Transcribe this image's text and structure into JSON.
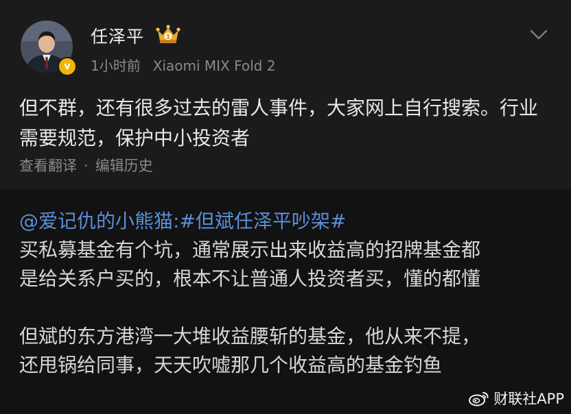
{
  "post": {
    "author": "任泽平",
    "time": "1小时前",
    "device": "Xiaomi MIX Fold 2",
    "verified_badge": "v",
    "text": "但不群，还有很多过去的雷人事件，大家网上自行搜索。行业需要规范，保护中小投资者",
    "actions": {
      "translate": "查看翻译",
      "separator": "·",
      "history": "编辑历史"
    }
  },
  "repost": {
    "mention": "@爱记仇的小熊猫",
    "colon": ":",
    "hashtag": "#但斌任泽平吵架#",
    "lines": [
      "买私募基金有个坑，通常展示出来收益高的招牌基金都",
      "是给关系户买的，根本不让普通人投资者买，懂的都懂",
      "但斌的东方港湾一大堆收益腰斩的基金，他从来不提，",
      "还甩锅给同事，天天吹嘘那几个收益高的基金钓鱼"
    ]
  },
  "watermark": {
    "text": "财联社APP"
  },
  "icons": {
    "crown": "crown-badge-icon",
    "chevron": "chevron-down-icon",
    "watermark_logo": "weibo-logo-icon"
  },
  "colors": {
    "link": "#5b8fd8",
    "verified": "#f2b600",
    "crown": "#e8a93a"
  }
}
